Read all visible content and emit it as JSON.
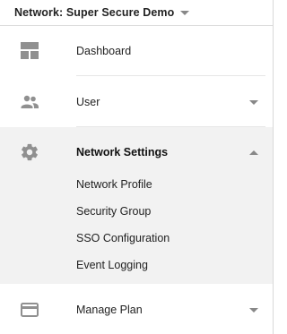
{
  "network": {
    "label": "Network: Super Secure Demo",
    "dropdown_icon": "caret-down"
  },
  "nav": {
    "dashboard": {
      "label": "Dashboard",
      "icon": "dashboard-icon"
    },
    "user": {
      "label": "User",
      "icon": "users-icon"
    },
    "network_settings": {
      "label": "Network Settings",
      "icon": "gear-icon",
      "expanded": true,
      "subitems": [
        "Network Profile",
        "Security Group",
        "SSO Configuration",
        "Event Logging"
      ]
    },
    "manage_plan": {
      "label": "Manage Plan",
      "icon": "credit-card-icon"
    }
  },
  "colors": {
    "active_background": "#f2f2f2",
    "icon_gray": "#909090",
    "caret_gray": "#888888"
  }
}
